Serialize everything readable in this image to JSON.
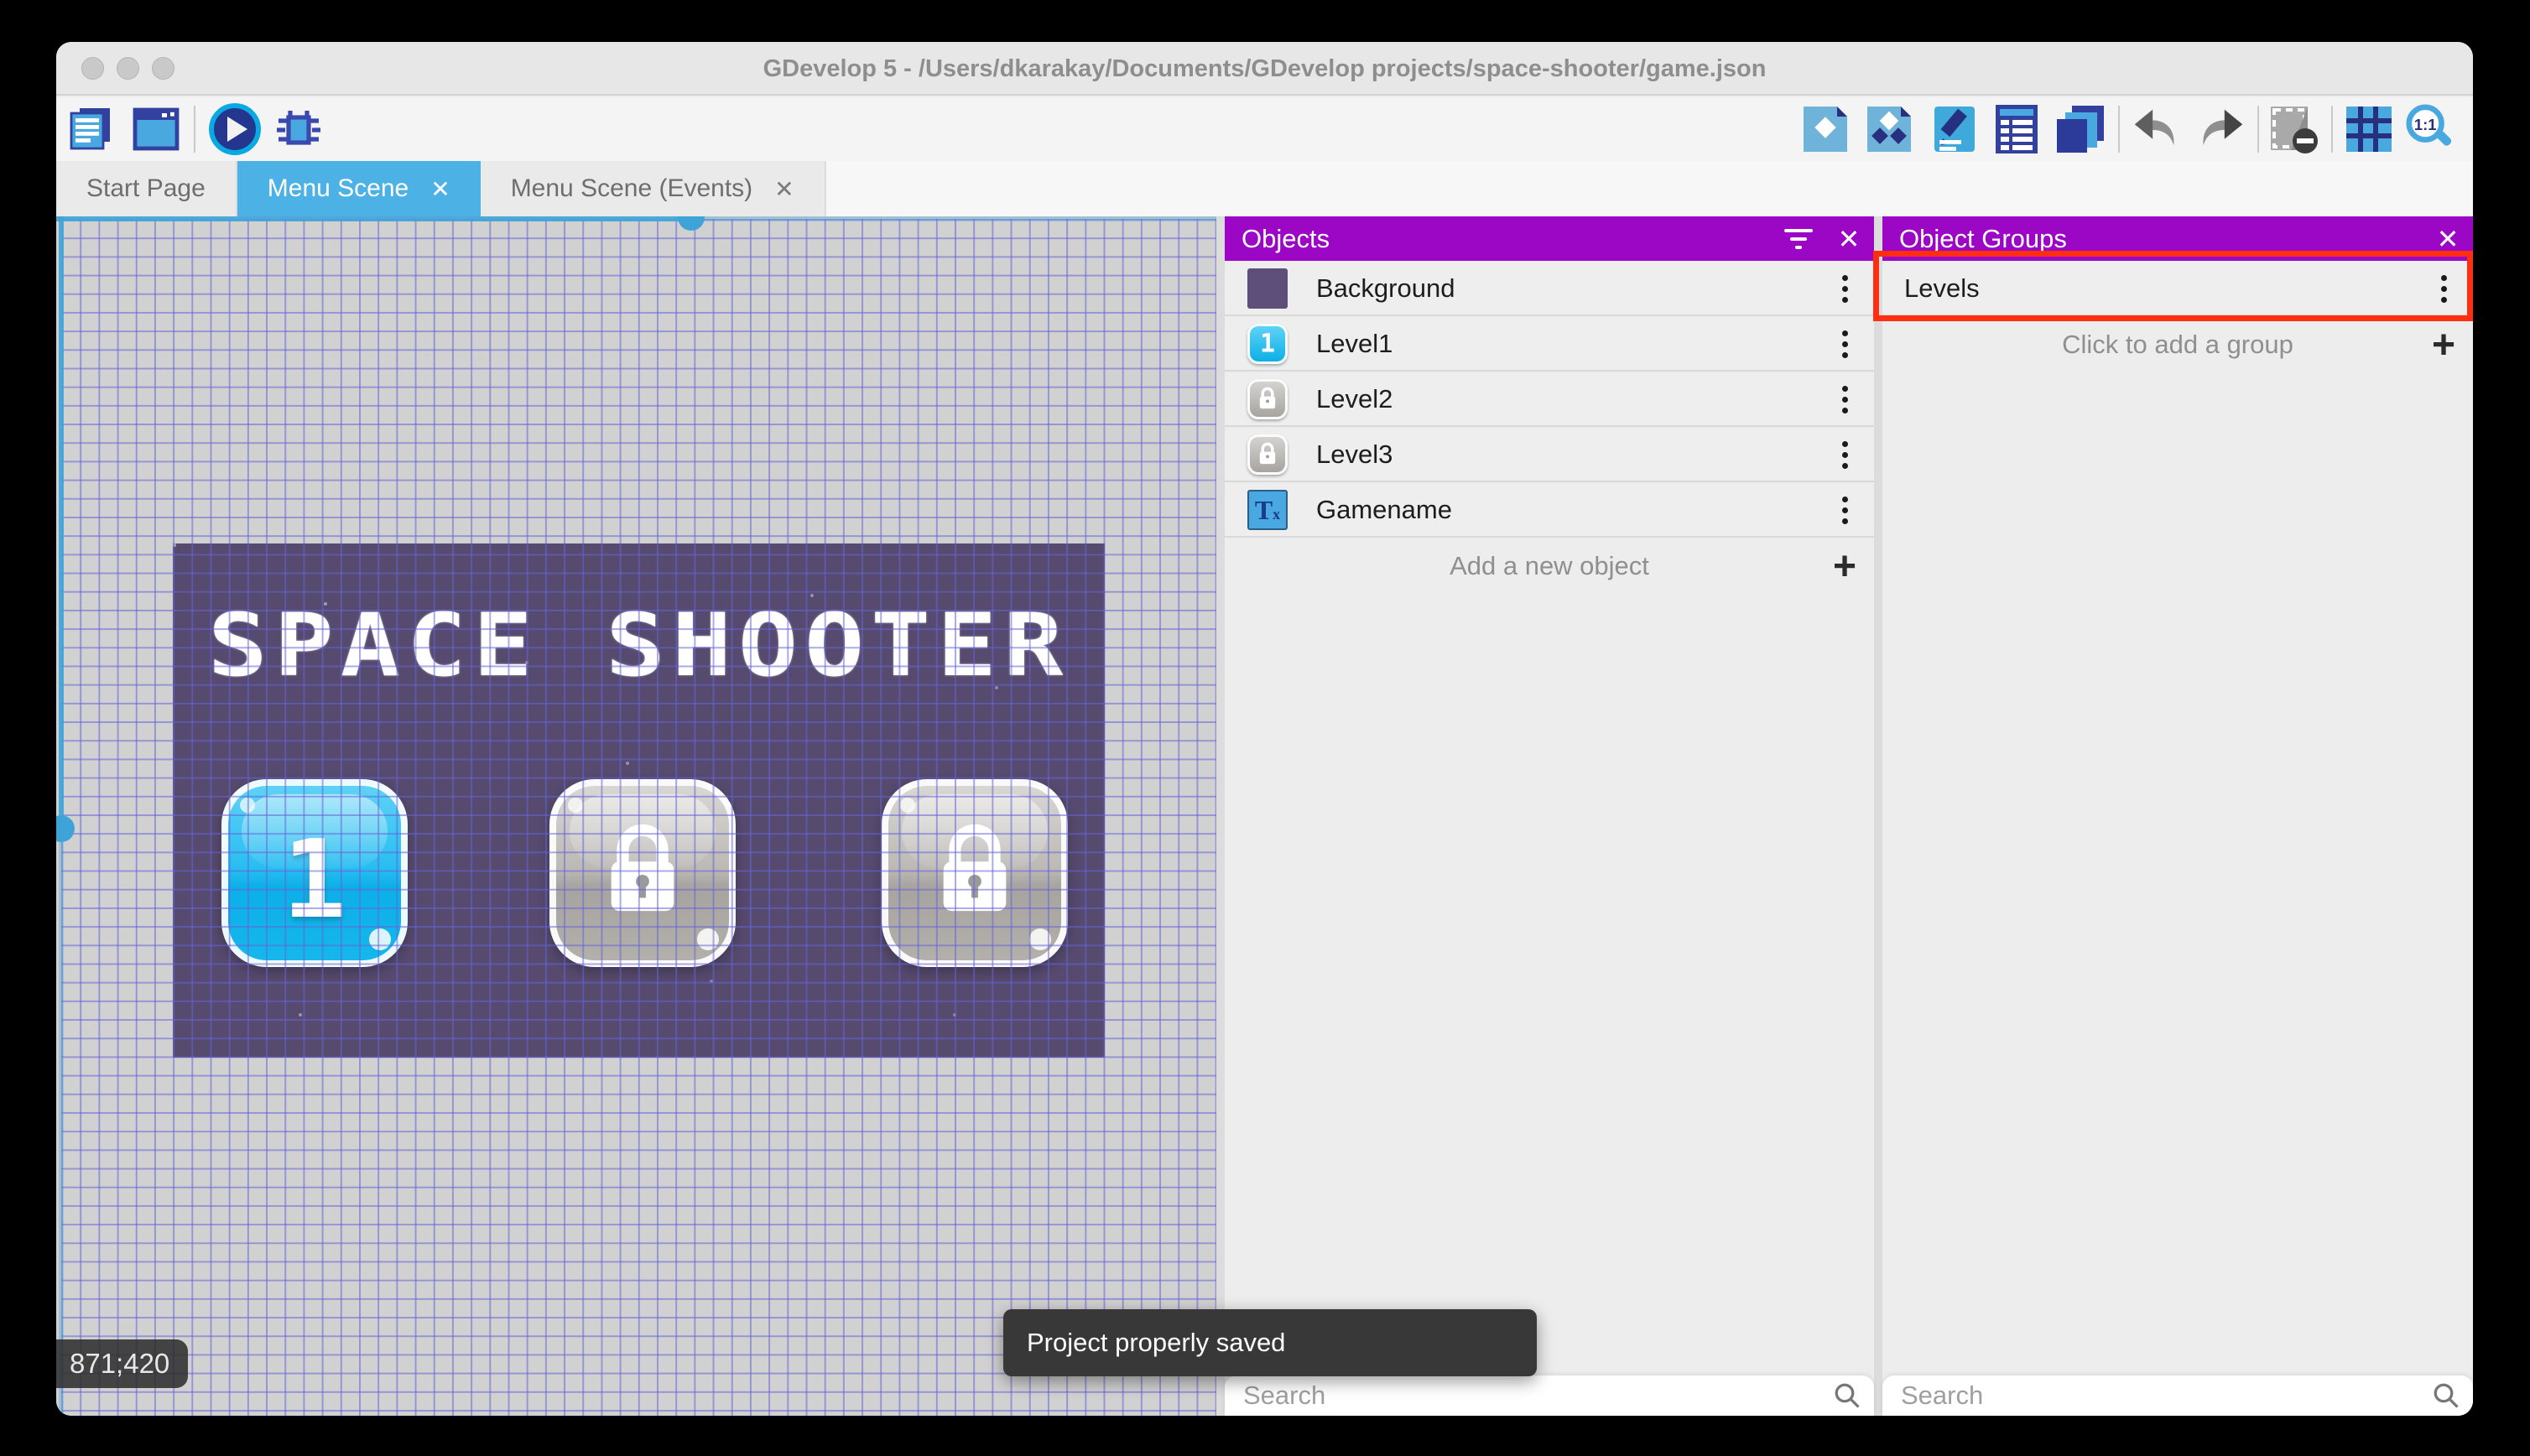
{
  "window": {
    "title": "GDevelop 5 - /Users/dkarakay/Documents/GDevelop projects/space-shooter/game.json"
  },
  "tabs": [
    {
      "label": "Start Page"
    },
    {
      "label": "Menu Scene"
    },
    {
      "label": "Menu Scene (Events)"
    }
  ],
  "toolbar": {
    "left_icons": [
      "project-manager",
      "scene-editor",
      "preview-play",
      "debug"
    ],
    "right_icons": [
      "objects-panel",
      "object-groups-panel",
      "properties",
      "instances-list",
      "layers",
      "undo",
      "redo",
      "toggle-mask",
      "toggle-grid",
      "zoom-one-to-one"
    ]
  },
  "canvas": {
    "coordinates": "871;420",
    "scene_title": "SPACE SHOOTER",
    "level_buttons": [
      {
        "type": "number",
        "label": "1"
      },
      {
        "type": "locked"
      },
      {
        "type": "locked"
      }
    ]
  },
  "toast": {
    "message": "Project properly saved"
  },
  "objects_panel": {
    "title": "Objects",
    "items": [
      {
        "label": "Background",
        "thumb": "purple-swatch"
      },
      {
        "label": "Level1",
        "thumb": "blue-number-button"
      },
      {
        "label": "Level2",
        "thumb": "gray-lock-button"
      },
      {
        "label": "Level3",
        "thumb": "gray-lock-button"
      },
      {
        "label": "Gamename",
        "thumb": "text-object"
      }
    ],
    "add_label": "Add a new object",
    "search_placeholder": "Search"
  },
  "groups_panel": {
    "title": "Object Groups",
    "items": [
      {
        "label": "Levels"
      }
    ],
    "add_label": "Click to add a group",
    "search_placeholder": "Search"
  },
  "colors": {
    "accent_blue": "#4cb1e4",
    "header_purple": "#9c07c6",
    "annotation_red": "#fe2e10",
    "scene_purple": "#564a6e",
    "toast_bg": "#383838"
  }
}
